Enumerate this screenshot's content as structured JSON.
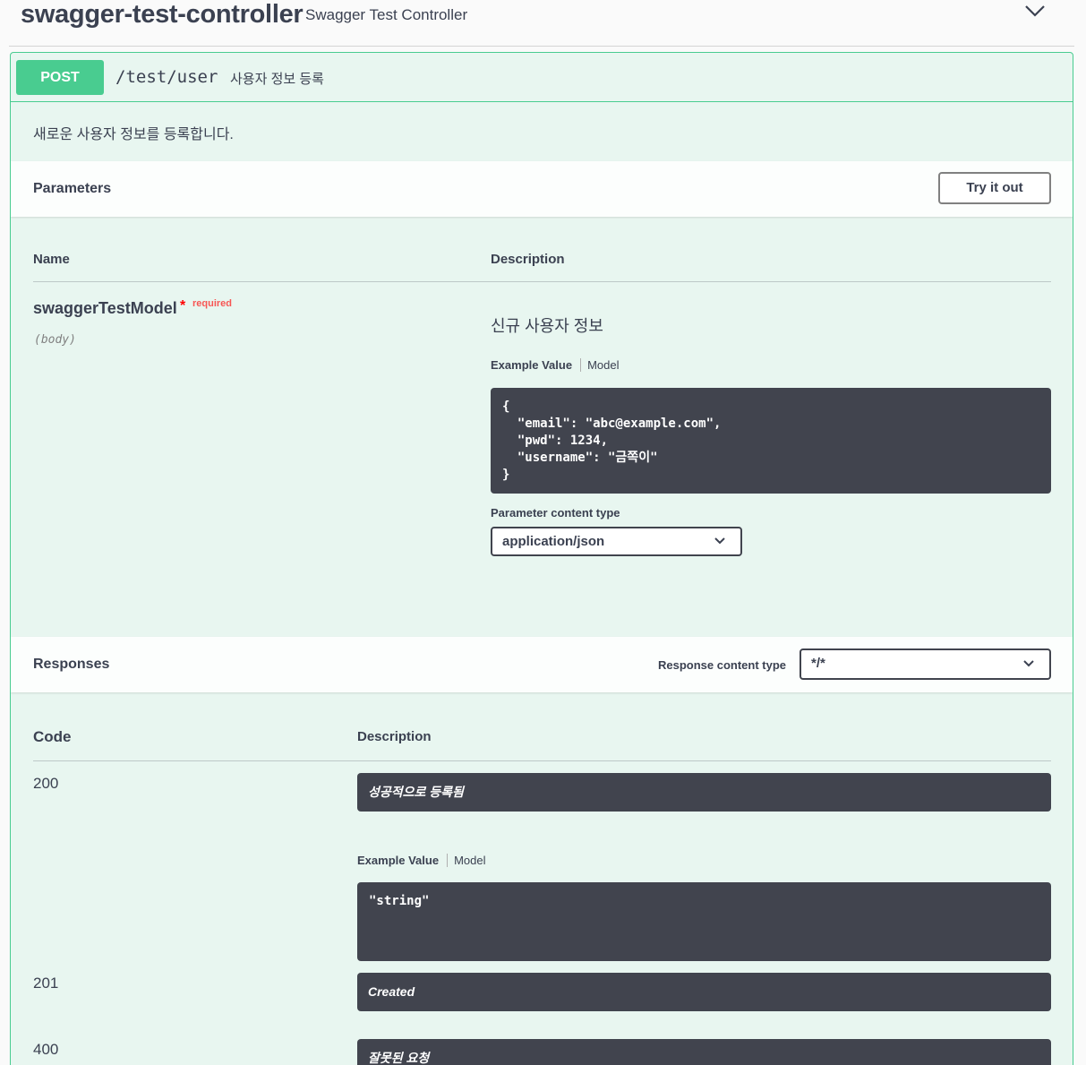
{
  "tag": {
    "name": "swagger-test-controller",
    "description": "Swagger Test Controller",
    "toggle_icon": "chevron-down-icon"
  },
  "operation": {
    "method": "POST",
    "path": "/test/user",
    "summary": "사용자 정보 등록",
    "description": "새로운 사용자 정보를 등록합니다.",
    "accent_color": "#49cc90"
  },
  "parameters": {
    "title": "Parameters",
    "try_label": "Try it out",
    "col_name": "Name",
    "col_description": "Description",
    "items": [
      {
        "name": "swaggerTestModel",
        "required_star": "*",
        "required_label": "required",
        "in": "(body)",
        "description": "신규 사용자 정보",
        "tab_example": "Example Value",
        "tab_model": "Model",
        "example": "{\n  \"email\": \"abc@example.com\",\n  \"pwd\": 1234,\n  \"username\": \"금쪽이\"\n}"
      }
    ],
    "content_type_label": "Parameter content type",
    "content_type_value": "application/json"
  },
  "responses": {
    "title": "Responses",
    "content_type_label": "Response content type",
    "content_type_value": "*/*",
    "col_code": "Code",
    "col_description": "Description",
    "items": [
      {
        "code": "200",
        "description": "성공적으로 등록됨",
        "tab_example": "Example Value",
        "tab_model": "Model",
        "example": "\"string\""
      },
      {
        "code": "201",
        "description": "Created"
      },
      {
        "code": "400",
        "description": "잘못된 요청"
      }
    ]
  }
}
